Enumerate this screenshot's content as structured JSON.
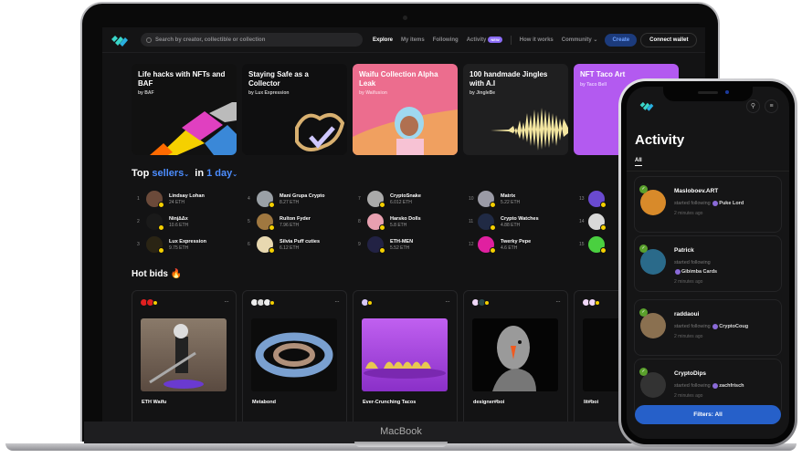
{
  "device": {
    "laptop_brand": "MacBook"
  },
  "nav": {
    "search_placeholder": "Search by creator, collectible or collection",
    "links": [
      {
        "label": "Explore",
        "active": true
      },
      {
        "label": "My items",
        "active": false
      },
      {
        "label": "Following",
        "active": false
      },
      {
        "label": "Activity",
        "active": false,
        "badge": "NEW"
      },
      {
        "label": "How it works",
        "active": false
      },
      {
        "label": "Community ⌄",
        "active": false
      }
    ],
    "create_label": "Create",
    "wallet_label": "Connect wallet"
  },
  "features": [
    {
      "title": "Life hacks with NFTs and BAF",
      "by": "by BAF"
    },
    {
      "title": "Staying Safe as a Collector",
      "by": "by Lux Expression"
    },
    {
      "title": "Waifu Collection Alpha Leak",
      "by": "by Waifusion"
    },
    {
      "title": "100 handmade Jingles with A.I",
      "by": "by JingleBe"
    },
    {
      "title": "NFT Taco Art",
      "by": "by Taco Bell"
    }
  ],
  "top_sellers": {
    "prefix": "Top",
    "category": "sellers",
    "in": "in",
    "period": "1 day",
    "items": [
      {
        "rank": "1",
        "name": "Lindsay Lohan",
        "eth": "24 ETH",
        "color": "#6b4a3a"
      },
      {
        "rank": "2",
        "name": "Ninj∆Δx",
        "eth": "10.6 ETH",
        "color": "#1a1a1a"
      },
      {
        "rank": "3",
        "name": "Lux Expression",
        "eth": "9.75 ETH",
        "color": "#2a2414"
      },
      {
        "rank": "4",
        "name": "Mani Grupa Crypto",
        "eth": "8.27 ETH",
        "color": "#9aa0a6"
      },
      {
        "rank": "5",
        "name": "Rulton Fyder",
        "eth": "7.96 ETH",
        "color": "#a07840"
      },
      {
        "rank": "6",
        "name": "Silvia Puff cuties",
        "eth": "6.12 ETH",
        "color": "#e8d8b0"
      },
      {
        "rank": "7",
        "name": "CryptoSnake",
        "eth": "6.012 ETH",
        "color": "#aaaaaa"
      },
      {
        "rank": "8",
        "name": "Harsko Dolls",
        "eth": "5.8 ETH",
        "color": "#e8a0b0"
      },
      {
        "rank": "9",
        "name": "ETH-MEN",
        "eth": "5.52 ETH",
        "color": "#222244"
      },
      {
        "rank": "10",
        "name": "Matrix",
        "eth": "5.22 ETH",
        "color": "#9b9ba6"
      },
      {
        "rank": "11",
        "name": "Crypto Watches",
        "eth": "4.88 ETH",
        "color": "#202a44"
      },
      {
        "rank": "12",
        "name": "Twerky Pepe",
        "eth": "4.6 ETH",
        "color": "#e020a0"
      },
      {
        "rank": "13",
        "name": "",
        "eth": "",
        "color": "#6a4ad0"
      },
      {
        "rank": "14",
        "name": "",
        "eth": "",
        "color": "#d8d8d8"
      },
      {
        "rank": "15",
        "name": "",
        "eth": "",
        "color": "#4ad040"
      }
    ]
  },
  "hot_bids": {
    "title": "Hot bids 🔥",
    "more": "···",
    "items": [
      {
        "name": "ETH Waifu"
      },
      {
        "name": "Metabond"
      },
      {
        "name": "Ever-Crunching Tacos"
      },
      {
        "name": "designer#boi"
      },
      {
        "name": "lit#boi"
      }
    ]
  },
  "phone": {
    "title": "Activity",
    "tab": "All",
    "filter_label": "Filters: All",
    "activities": [
      {
        "user": "Masloboev.ART",
        "action": "started following",
        "target": "Puke Lord",
        "time": "2 minutes ago",
        "color": "#d88a2a"
      },
      {
        "user": "Patrick",
        "action": "started following",
        "target": "Gibimba Cards",
        "time": "2 minutes ago",
        "color": "#2a6a8a"
      },
      {
        "user": "raddaoui",
        "action": "started following",
        "target": "CryptoCoug",
        "time": "2 minutes ago",
        "color": "#8a7050"
      },
      {
        "user": "CryptoDips",
        "action": "started following",
        "target": "zachfrisch",
        "time": "2 minutes ago",
        "color": "#333"
      }
    ]
  }
}
